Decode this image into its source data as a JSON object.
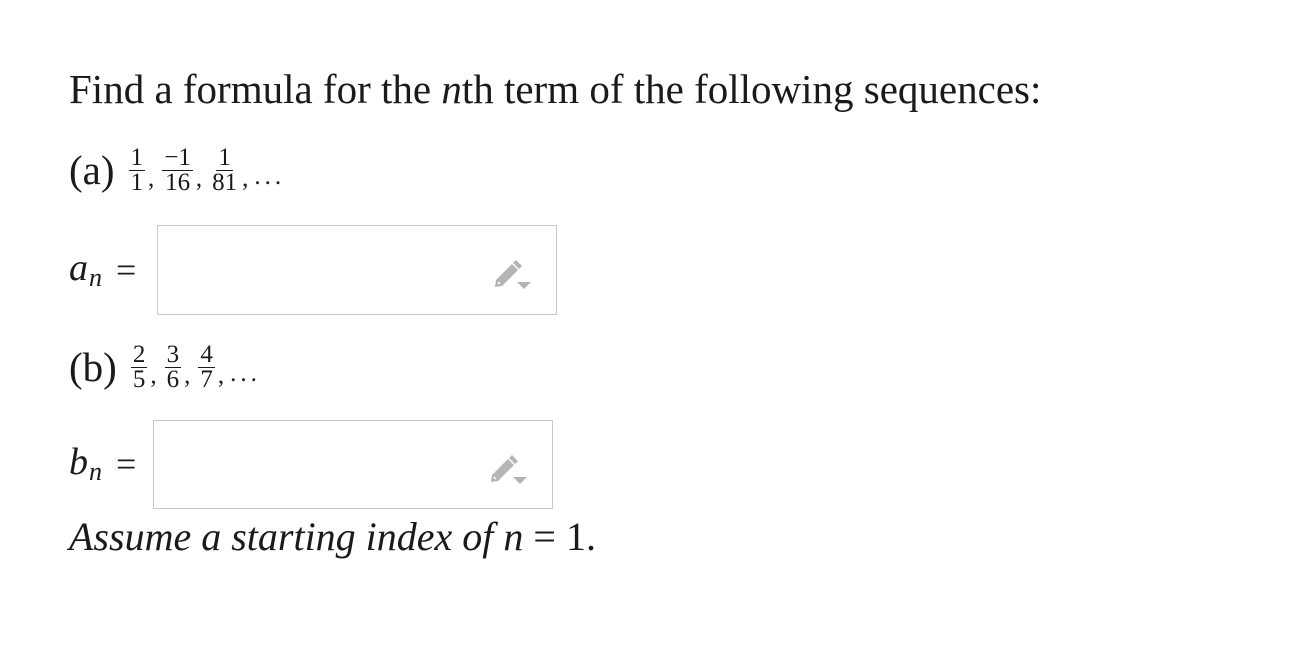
{
  "prompt": {
    "before": "Find a formula for the ",
    "nth_var": "n",
    "after": "th term of the following sequences:"
  },
  "part_a": {
    "label": "(a)",
    "terms": [
      {
        "num": "1",
        "den": "1"
      },
      {
        "num": "−1",
        "den": "16"
      },
      {
        "num": "1",
        "den": "81"
      }
    ],
    "comma": ",",
    "ellipsis": "...",
    "var": "a",
    "sub": "n",
    "eq": "="
  },
  "part_b": {
    "label": "(b)",
    "terms": [
      {
        "num": "2",
        "den": "5"
      },
      {
        "num": "3",
        "den": "6"
      },
      {
        "num": "4",
        "den": "7"
      }
    ],
    "comma": ",",
    "ellipsis": "...",
    "var": "b",
    "sub": "n",
    "eq": "="
  },
  "note": {
    "text": "Assume a starting index of ",
    "var": "n",
    "eq": " = 1."
  },
  "icons": {
    "answer_edit": "pencil-dropdown-icon"
  },
  "colors": {
    "box_border": "#c9c9c9",
    "icon_gray": "#b5b5b5",
    "text": "#1a1a1a"
  }
}
